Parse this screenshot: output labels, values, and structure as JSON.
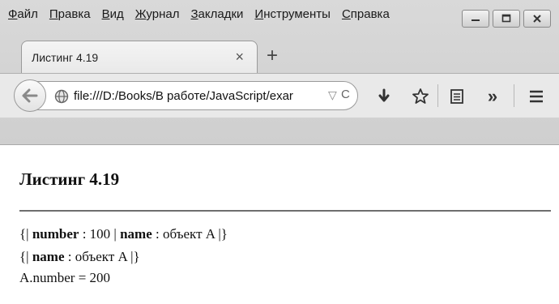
{
  "menu": [
    {
      "first": "Ф",
      "rest": "айл"
    },
    {
      "first": "П",
      "rest": "равка"
    },
    {
      "first": "В",
      "rest": "ид"
    },
    {
      "first": "Ж",
      "rest": "урнал"
    },
    {
      "first": "З",
      "rest": "акладки"
    },
    {
      "first": "И",
      "rest": "нструменты"
    },
    {
      "first": "С",
      "rest": "правка"
    }
  ],
  "tab": {
    "title": "Листинг 4.19",
    "close": "×"
  },
  "newtab": "+",
  "urlbar": {
    "url": "file:///D:/Books/В работе/JavaScript/exar",
    "drop": "▽",
    "reload": "C"
  },
  "toolbar": {
    "overflow": "»"
  },
  "page": {
    "heading": "Листинг 4.19",
    "line1": {
      "open": "{| ",
      "k1": "number",
      "v1": " : 100 | ",
      "k2": "name",
      "v2": " : объект A |}"
    },
    "line2": {
      "open": "{| ",
      "k1": "name",
      "v1": " : объект A |}"
    },
    "line3": "A.number = 200"
  }
}
